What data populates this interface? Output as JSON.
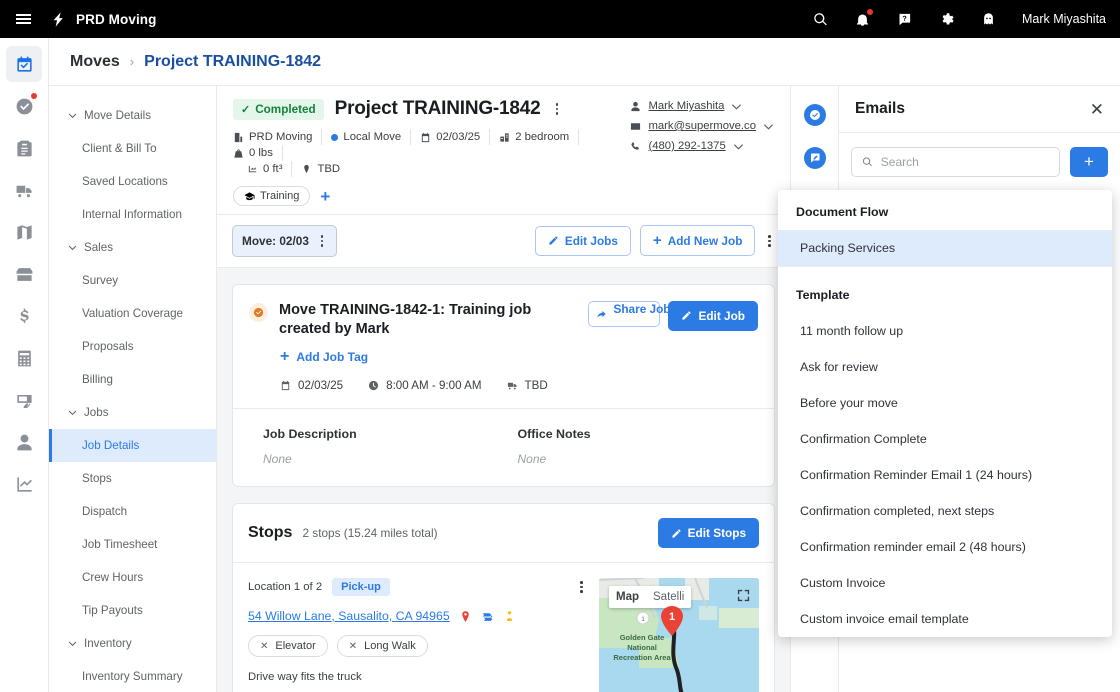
{
  "topbar": {
    "brand": "PRD Moving",
    "menu_icon": "hamburger-icon",
    "logo_icon": "bolt-logo-icon",
    "icons": [
      "search-icon",
      "bell-icon",
      "help-chat-icon",
      "gear-icon",
      "ghost-icon"
    ],
    "user": "Mark Miyashita"
  },
  "rail": {
    "items": [
      {
        "icon": "calendar-check-icon",
        "active": true,
        "dot": false
      },
      {
        "icon": "check-circle-icon",
        "active": false,
        "dot": true
      },
      {
        "icon": "clipboard-icon",
        "active": false,
        "dot": false
      },
      {
        "icon": "truck-icon",
        "active": false,
        "dot": false
      },
      {
        "icon": "map-icon",
        "active": false,
        "dot": false
      },
      {
        "icon": "box-icon",
        "active": false,
        "dot": false
      },
      {
        "icon": "dollar-icon",
        "active": false,
        "dot": false
      },
      {
        "icon": "calculator-icon",
        "active": false,
        "dot": false
      },
      {
        "icon": "invoice-icon",
        "active": false,
        "dot": false
      },
      {
        "icon": "person-icon",
        "active": false,
        "dot": false
      },
      {
        "icon": "chart-icon",
        "active": false,
        "dot": false
      }
    ]
  },
  "breadcrumb": {
    "root": "Moves",
    "separator": "›",
    "current": "Project TRAINING-1842"
  },
  "sidebar": {
    "groups": [
      {
        "label": "Move Details",
        "items": [
          "Client & Bill To",
          "Saved Locations",
          "Internal Information"
        ]
      },
      {
        "label": "Sales",
        "items": [
          "Survey",
          "Valuation Coverage",
          "Proposals",
          "Billing"
        ]
      },
      {
        "label": "Jobs",
        "items": [
          "Job Details",
          "Stops",
          "Dispatch",
          "Job Timesheet",
          "Crew Hours",
          "Tip Payouts"
        ]
      },
      {
        "label": "Inventory",
        "items": [
          "Inventory Summary"
        ]
      }
    ],
    "active_item": "Job Details"
  },
  "header": {
    "status_badge": "Completed",
    "status_tick": "✓",
    "title": "Project TRAINING-1842",
    "meta": [
      {
        "icon": "building-icon",
        "text": "PRD Moving"
      },
      {
        "icon": "dot-blue-icon",
        "text": "Local Move"
      },
      {
        "icon": "calendar-icon",
        "text": "02/03/25"
      },
      {
        "icon": "home-icon",
        "text": "2 bedroom"
      },
      {
        "icon": "weight-icon",
        "text": "0 lbs"
      },
      {
        "icon": "volume-icon",
        "text": "0 ft³"
      },
      {
        "icon": "pin-icon",
        "text": "TBD"
      }
    ],
    "tag": "Training",
    "add_tag_plus": "+",
    "contact": [
      {
        "icon": "person-icon",
        "text": "Mark Miyashita"
      },
      {
        "icon": "envelope-icon",
        "text": "mark@supermove.co"
      },
      {
        "icon": "phone-icon",
        "text": "(480) 292-1375"
      }
    ]
  },
  "toolbar": {
    "move_tab": "Move: 02/03",
    "edit_jobs": "Edit Jobs",
    "add_new_job": "Add New Job"
  },
  "job": {
    "title": "Move TRAINING-1842-1: Training job created by Mark",
    "share_label": "Share Job",
    "edit_label": "Edit Job",
    "add_job_tag": "Add Job Tag",
    "date": "02/03/25",
    "time": "8:00 AM - 9:00 AM",
    "crew": "TBD",
    "job_description_label": "Job Description",
    "job_description_value": "None",
    "office_notes_label": "Office Notes",
    "office_notes_value": "None"
  },
  "stops": {
    "title": "Stops",
    "subtitle": "2 stops (15.24 miles total)",
    "edit_label": "Edit Stops",
    "location_label": "Location 1 of 2",
    "location_chip": "Pick-up",
    "address": "54 Willow Lane, Sausalito, CA 94965",
    "amenities": [
      {
        "label": "Elevator",
        "mark": "✕"
      },
      {
        "label": "Long Walk",
        "mark": "✕"
      }
    ],
    "note": "Drive way fits the truck",
    "map": {
      "map_label": "Map",
      "satellite_label": "Satelli",
      "marker": "1",
      "area_label": "Golden Gate National Recreation Area"
    }
  },
  "right_rail": {
    "icons": [
      "check-circle-blue-icon",
      "chat-edit-blue-icon"
    ]
  },
  "email_panel": {
    "title": "Emails",
    "close": "✕",
    "search_placeholder": "Search",
    "search_value": "",
    "add": "+"
  },
  "dropdown": {
    "section_document_flow": "Document Flow",
    "document_flow_items": [
      {
        "label": "Packing Services",
        "selected": true
      }
    ],
    "section_template": "Template",
    "template_items": [
      {
        "label": "11 month follow up",
        "selected": false
      },
      {
        "label": "Ask for review",
        "selected": false
      },
      {
        "label": "Before your move",
        "selected": false
      },
      {
        "label": "Confirmation Complete",
        "selected": false
      },
      {
        "label": "Confirmation Reminder Email 1 (24 hours)",
        "selected": false
      },
      {
        "label": "Confirmation completed, next steps",
        "selected": false
      },
      {
        "label": "Confirmation reminder email 2 (48 hours)",
        "selected": false
      },
      {
        "label": "Custom Invoice",
        "selected": false
      },
      {
        "label": "Custom invoice email template",
        "selected": false
      }
    ]
  },
  "colors": {
    "accent": "#2c7be5",
    "success": "#14833b",
    "danger": "#e8392e",
    "topbar": "#000000"
  }
}
